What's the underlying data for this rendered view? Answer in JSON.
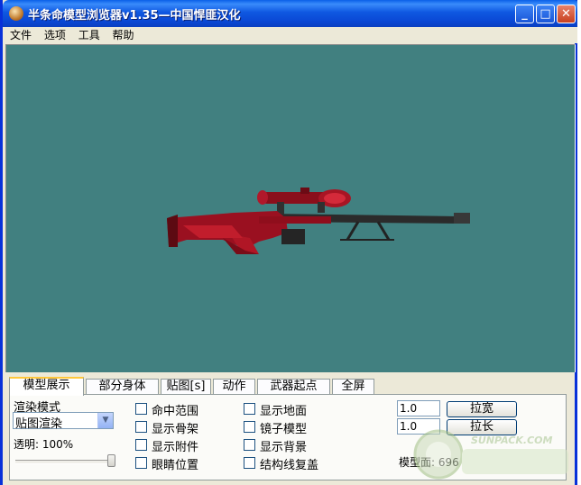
{
  "window": {
    "title": "半条命模型浏览器v1.35—中国悍匪汉化",
    "controls": {
      "minimize": "_",
      "maximize": "□",
      "close": "✕"
    }
  },
  "menu": [
    "文件",
    "选项",
    "工具",
    "帮助"
  ],
  "viewport": {
    "background": "#418080",
    "model": "sniper-rifle-red"
  },
  "tabs": [
    "模型展示",
    "部分身体",
    "贴图[s]",
    "动作",
    "武器起点",
    "全屏"
  ],
  "active_tab": 0,
  "render": {
    "mode_label": "渲染模式",
    "mode_value": "贴图渲染",
    "opacity_label": "透明: 100%",
    "opacity_value": 1.0
  },
  "checkboxes_col1": [
    "命中范围",
    "显示骨架",
    "显示附件",
    "眼睛位置"
  ],
  "checkboxes_col2": [
    "显示地面",
    "镜子模型",
    "显示背景",
    "结构线复盖"
  ],
  "scale": {
    "width_value": "1.0",
    "width_button": "拉宽",
    "length_value": "1.0",
    "length_button": "拉长"
  },
  "model_info": "模型面: 696",
  "watermark": "SUNPACK.COM"
}
